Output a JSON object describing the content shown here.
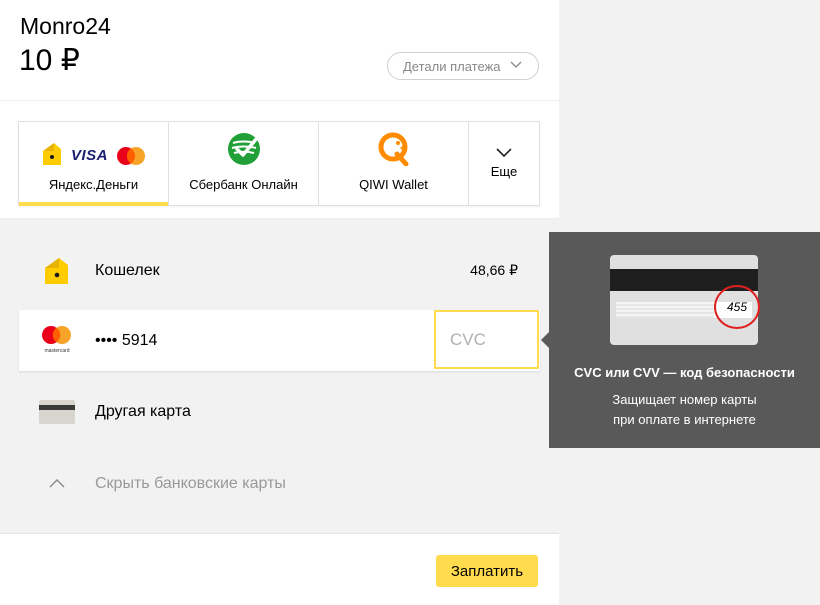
{
  "header": {
    "merchant": "Monro24",
    "amount": "10 ₽",
    "details_label": "Детали платежа"
  },
  "methods": [
    {
      "label": "Яндекс.Деньги",
      "active": true
    },
    {
      "label": "Сбербанк Онлайн",
      "active": false
    },
    {
      "label": "QIWI Wallet",
      "active": false
    },
    {
      "label": "Еще",
      "active": false
    }
  ],
  "visa_text": "VISA",
  "mastercard_text": "mastercard",
  "wallet": {
    "label": "Кошелек",
    "balance": "48,66 ₽"
  },
  "card": {
    "number": "•••• 5914",
    "cvc_placeholder": "CVC"
  },
  "other_card": {
    "label": "Другая карта"
  },
  "hide_cards": {
    "label": "Скрыть банковские карты"
  },
  "pay_button": {
    "label": "Заплатить"
  },
  "tooltip": {
    "cvc_sample": "455",
    "title": "CVC или CVV — код безопасности",
    "text_line1": "Защищает номер карты",
    "text_line2": "при оплате в интернете"
  },
  "colors": {
    "accent_yellow": "#ffdb4d",
    "sber_green": "#21a038",
    "qiwi_orange": "#ff8c00",
    "tooltip_bg": "#595959",
    "mastercard_red": "#eb001b",
    "mastercard_orange": "#f79e1b"
  }
}
